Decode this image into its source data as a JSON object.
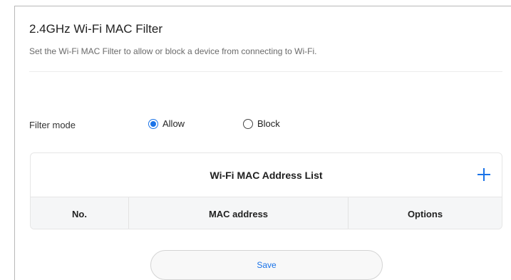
{
  "page": {
    "title": "2.4GHz Wi-Fi MAC Filter",
    "description": "Set the Wi-Fi MAC Filter to allow or block a device from connecting to Wi-Fi."
  },
  "filter_mode": {
    "label": "Filter mode",
    "options": [
      {
        "label": "Allow",
        "checked": true
      },
      {
        "label": "Block",
        "checked": false
      }
    ],
    "selected": "Allow"
  },
  "mac_list": {
    "title": "Wi-Fi MAC Address List",
    "add_icon": "plus-icon",
    "columns": [
      "No.",
      "MAC address",
      "Options"
    ],
    "rows": []
  },
  "actions": {
    "save_label": "Save"
  },
  "colors": {
    "accent": "#1a73e8",
    "header_bg": "#f5f6f7"
  }
}
